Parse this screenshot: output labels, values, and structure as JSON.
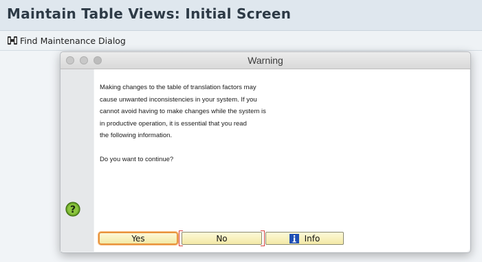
{
  "header": {
    "title": "Maintain Table Views: Initial Screen"
  },
  "toolbar": {
    "find_label": "Find Maintenance Dialog",
    "find_icon": "find-binoculars-icon"
  },
  "dialog": {
    "title": "Warning",
    "icon": "question-icon",
    "message_lines": [
      "Making changes to the table of translation factors may",
      "cause unwanted inconsistencies in your system. If you",
      "cannot avoid having to make changes while the system is",
      "in productive operation, it is essential that you read",
      "the following information."
    ],
    "question": "Do you want to continue?",
    "buttons": {
      "yes": "Yes",
      "no": "No",
      "info": "Info"
    }
  },
  "colors": {
    "accent_focus": "#e8923a",
    "button_bg": "#f7efb8",
    "info_icon": "#1f4fb5",
    "question_icon": "#6ea92a"
  }
}
